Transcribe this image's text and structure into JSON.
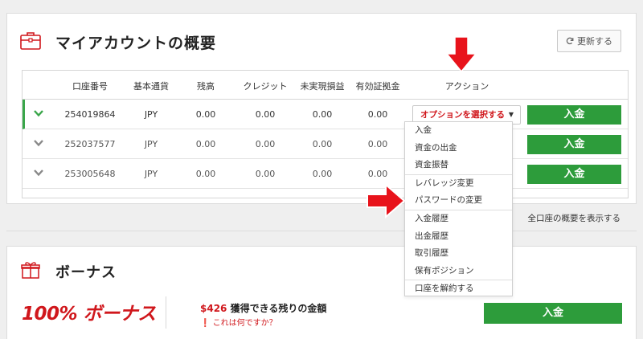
{
  "overview": {
    "title": "マイアカウントの概要",
    "refresh_label": "更新する",
    "columns": [
      "口座番号",
      "基本通貨",
      "残高",
      "クレジット",
      "未実現損益",
      "有効証拠金",
      "アクション"
    ],
    "rows": [
      {
        "account": "254019864",
        "currency": "JPY",
        "balance": "0.00",
        "credit": "0.00",
        "unrealized": "0.00",
        "equity": "0.00",
        "state": "active"
      },
      {
        "account": "252037577",
        "currency": "JPY",
        "balance": "0.00",
        "credit": "0.00",
        "unrealized": "0.00",
        "equity": "0.00",
        "state": "inactive"
      },
      {
        "account": "253005648",
        "currency": "JPY",
        "balance": "0.00",
        "credit": "0.00",
        "unrealized": "0.00",
        "equity": "0.00",
        "state": "inactive"
      }
    ],
    "select_placeholder": "オプションを選択する",
    "deposit_label": "入金",
    "footer_link": "全口座の概要を表示する"
  },
  "dropdown": {
    "items": [
      "入金",
      "資金の出金",
      "資金振替",
      "レバレッジ変更",
      "パスワードの変更",
      "入金履歴",
      "出金履歴",
      "取引履歴",
      "保有ポジション",
      "口座を解約する"
    ]
  },
  "bonus": {
    "title": "ボーナス",
    "headline": "100% ボーナス",
    "amount": "$426",
    "amount_text": "獲得できる残りの金額",
    "help_text": "これは何ですか？",
    "deposit_label": "入金"
  },
  "icons": {
    "account_icon": "briefcase-icon",
    "bonus_icon": "gift-icon",
    "refresh_icon": "refresh-icon",
    "row_expand_icon": "chevron-down-icon",
    "help_icon": "exclamation-circle-icon",
    "annotation_arrows": "red-arrow-icon"
  },
  "colors": {
    "brand_red": "#d0171c",
    "deposit_green": "#2d9c3b",
    "active_row_accent": "#3aa64a"
  }
}
